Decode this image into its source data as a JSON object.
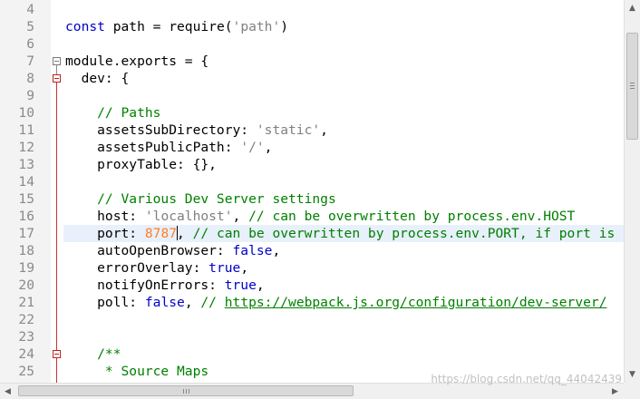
{
  "editor": {
    "current_line": 17,
    "lines": [
      {
        "n": "4",
        "tokens": []
      },
      {
        "n": "5",
        "tokens": [
          {
            "t": "kw",
            "v": "const"
          },
          {
            "t": "plain",
            "v": " path = require("
          },
          {
            "t": "str",
            "v": "'path'"
          },
          {
            "t": "plain",
            "v": ")"
          }
        ]
      },
      {
        "n": "6",
        "tokens": []
      },
      {
        "n": "7",
        "tokens": [
          {
            "t": "plain",
            "v": "module.exports = {"
          }
        ]
      },
      {
        "n": "8",
        "tokens": [
          {
            "t": "plain",
            "v": "  dev: {"
          }
        ]
      },
      {
        "n": "9",
        "tokens": []
      },
      {
        "n": "10",
        "tokens": [
          {
            "t": "cmt",
            "v": "    // Paths"
          }
        ]
      },
      {
        "n": "11",
        "tokens": [
          {
            "t": "plain",
            "v": "    assetsSubDirectory: "
          },
          {
            "t": "str",
            "v": "'static'"
          },
          {
            "t": "plain",
            "v": ","
          }
        ]
      },
      {
        "n": "12",
        "tokens": [
          {
            "t": "plain",
            "v": "    assetsPublicPath: "
          },
          {
            "t": "str",
            "v": "'/'"
          },
          {
            "t": "plain",
            "v": ","
          }
        ]
      },
      {
        "n": "13",
        "tokens": [
          {
            "t": "plain",
            "v": "    proxyTable: {},"
          }
        ]
      },
      {
        "n": "14",
        "tokens": []
      },
      {
        "n": "15",
        "tokens": [
          {
            "t": "cmt",
            "v": "    // Various Dev Server settings"
          }
        ]
      },
      {
        "n": "16",
        "tokens": [
          {
            "t": "plain",
            "v": "    host: "
          },
          {
            "t": "str",
            "v": "'localhost'"
          },
          {
            "t": "plain",
            "v": ", "
          },
          {
            "t": "cmt",
            "v": "// can be overwritten by process.env.HOST"
          }
        ]
      },
      {
        "n": "17",
        "tokens": [
          {
            "t": "plain",
            "v": "    port: "
          },
          {
            "t": "num",
            "v": "8787"
          },
          {
            "t": "caret",
            "v": ""
          },
          {
            "t": "plain",
            "v": ", "
          },
          {
            "t": "cmt",
            "v": "// can be overwritten by process.env.PORT, if port is in use"
          }
        ]
      },
      {
        "n": "18",
        "tokens": [
          {
            "t": "plain",
            "v": "    autoOpenBrowser: "
          },
          {
            "t": "kw",
            "v": "false"
          },
          {
            "t": "plain",
            "v": ","
          }
        ]
      },
      {
        "n": "19",
        "tokens": [
          {
            "t": "plain",
            "v": "    errorOverlay: "
          },
          {
            "t": "kw",
            "v": "true"
          },
          {
            "t": "plain",
            "v": ","
          }
        ]
      },
      {
        "n": "20",
        "tokens": [
          {
            "t": "plain",
            "v": "    notifyOnErrors: "
          },
          {
            "t": "kw",
            "v": "true"
          },
          {
            "t": "plain",
            "v": ","
          }
        ]
      },
      {
        "n": "21",
        "tokens": [
          {
            "t": "plain",
            "v": "    poll: "
          },
          {
            "t": "kw",
            "v": "false"
          },
          {
            "t": "plain",
            "v": ", "
          },
          {
            "t": "cmt",
            "v": "// "
          },
          {
            "t": "link",
            "v": "https://webpack.js.org/configuration/dev-server/"
          }
        ]
      },
      {
        "n": "22",
        "tokens": []
      },
      {
        "n": "23",
        "tokens": []
      },
      {
        "n": "24",
        "tokens": [
          {
            "t": "cmt",
            "v": "    /**"
          }
        ]
      },
      {
        "n": "25",
        "tokens": [
          {
            "t": "cmt",
            "v": "     * Source Maps"
          }
        ]
      }
    ]
  },
  "watermark": "https://blog.csdn.net/qq_44042439",
  "icons": {
    "scroll_up": "▲",
    "scroll_down": "▼",
    "scroll_left": "◀",
    "scroll_right": "▶"
  }
}
